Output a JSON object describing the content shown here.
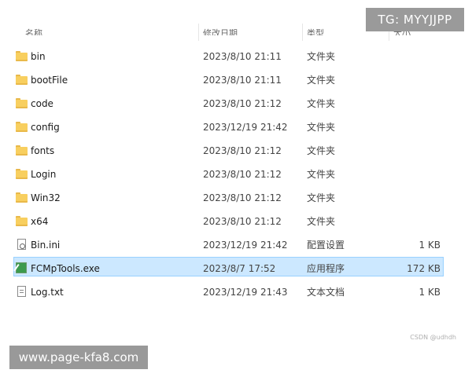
{
  "columns": {
    "name": "名称",
    "date": "修改日期",
    "type": "类型",
    "size": "大小"
  },
  "files": [
    {
      "name": "bin",
      "date": "2023/8/10 21:11",
      "type": "文件夹",
      "size": "",
      "icon": "folder-icon",
      "selected": false
    },
    {
      "name": "bootFile",
      "date": "2023/8/10 21:11",
      "type": "文件夹",
      "size": "",
      "icon": "folder-icon",
      "selected": false
    },
    {
      "name": "code",
      "date": "2023/8/10 21:12",
      "type": "文件夹",
      "size": "",
      "icon": "folder-icon",
      "selected": false
    },
    {
      "name": "config",
      "date": "2023/12/19 21:42",
      "type": "文件夹",
      "size": "",
      "icon": "folder-icon",
      "selected": false
    },
    {
      "name": "fonts",
      "date": "2023/8/10 21:12",
      "type": "文件夹",
      "size": "",
      "icon": "folder-icon",
      "selected": false
    },
    {
      "name": "Login",
      "date": "2023/8/10 21:12",
      "type": "文件夹",
      "size": "",
      "icon": "folder-icon",
      "selected": false
    },
    {
      "name": "Win32",
      "date": "2023/8/10 21:12",
      "type": "文件夹",
      "size": "",
      "icon": "folder-icon",
      "selected": false
    },
    {
      "name": "x64",
      "date": "2023/8/10 21:12",
      "type": "文件夹",
      "size": "",
      "icon": "folder-icon",
      "selected": false
    },
    {
      "name": "Bin.ini",
      "date": "2023/12/19 21:42",
      "type": "配置设置",
      "size": "1 KB",
      "icon": "config-file-icon",
      "selected": false
    },
    {
      "name": "FCMpTools.exe",
      "date": "2023/8/7 17:52",
      "type": "应用程序",
      "size": "172 KB",
      "icon": "application-icon",
      "selected": true
    },
    {
      "name": "Log.txt",
      "date": "2023/12/19 21:43",
      "type": "文本文档",
      "size": "1 KB",
      "icon": "text-file-icon",
      "selected": false
    }
  ],
  "watermarks": {
    "telegram": "TG: MYYJJPP",
    "site": "www.page-kfa8.com",
    "csdn": "CSDN @udhdh"
  },
  "colors": {
    "selection_bg": "#cce8ff",
    "selection_border": "#99d1ff",
    "folder": "#f8cf5f"
  }
}
